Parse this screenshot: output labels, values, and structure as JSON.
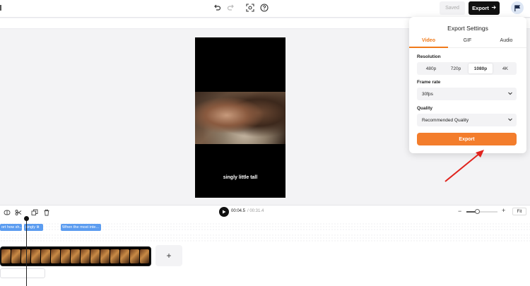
{
  "header": {
    "saved_label": "Saved",
    "export_label": "Export",
    "icons": [
      "undo-icon",
      "redo-icon",
      "screenshot-icon",
      "help-icon",
      "arrow-right-icon"
    ]
  },
  "preview": {
    "caption": "singly little tall"
  },
  "timeline": {
    "current_time": "00:04.5",
    "total_time": "00:31.4",
    "fit_label": "Fit",
    "zoom_level": 0.35,
    "subtitles": [
      {
        "text": "ort how sh..."
      },
      {
        "text": "singly lit"
      },
      {
        "text": "When the most inte..."
      }
    ],
    "add_label": "+"
  },
  "export_panel": {
    "title": "Export Settings",
    "tabs": [
      "Video",
      "GIF",
      "Audio"
    ],
    "active_tab": "Video",
    "resolution_label": "Resolution",
    "resolutions": [
      "480p",
      "720p",
      "1080p",
      "4K"
    ],
    "selected_resolution": "1080p",
    "frame_rate_label": "Frame rate",
    "frame_rate_value": "30fps",
    "quality_label": "Quality",
    "quality_value": "Recommended Quality",
    "export_button": "Export"
  },
  "colors": {
    "accent": "#f07a1a",
    "export_button": "#f37d2c",
    "subtitle_chip": "#5b9cf0",
    "annotation_arrow": "#e0241e"
  }
}
